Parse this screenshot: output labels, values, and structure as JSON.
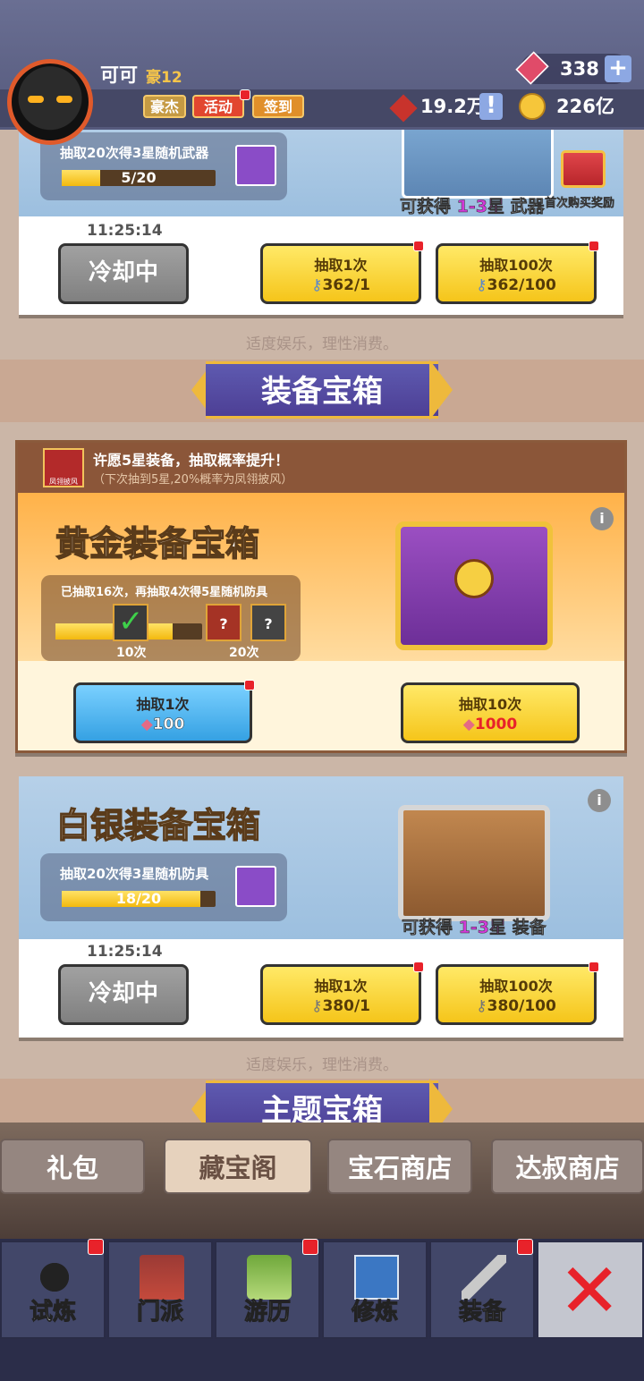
{
  "header": {
    "player_name": "可可",
    "vip_level": "豪12",
    "tag_buttons": [
      "豪杰",
      "活动",
      "签到"
    ],
    "gems": "338",
    "honor": "19.2万",
    "gold": "226亿"
  },
  "weapon_chest": {
    "progress_text": "抽取20次得3星随机武器",
    "progress_value": "5/20",
    "progress_fraction": 0.25,
    "reward_text_prefix": "可获得",
    "reward_stars": "1-3星",
    "reward_type": "武器",
    "first_purchase": "首次购买奖励",
    "timer": "11:25:14",
    "cooldown_label": "冷却中",
    "draw1_label": "抽取1次",
    "draw1_cost": "362/1",
    "draw100_label": "抽取100次",
    "draw100_cost": "362/100",
    "notice": "适度娱乐，理性消费。"
  },
  "equipment_banner": "装备宝箱",
  "wish": {
    "icon_label": "凤翎披风",
    "line1": "许愿5星装备，抽取概率提升！",
    "line2": "（下次抽到5星,20%概率为凤翎披风）"
  },
  "gold_chest": {
    "title": "黄金装备宝箱",
    "progress_text": "已抽取16次，再抽取4次得5星随机防具",
    "progress_fraction": 0.8,
    "mark1": "10次",
    "mark2": "20次",
    "draw1_label": "抽取1次",
    "draw1_cost": "100",
    "draw10_label": "抽取10次",
    "draw10_cost": "1000"
  },
  "silver_chest": {
    "title": "白银装备宝箱",
    "progress_text": "抽取20次得3星随机防具",
    "progress_value": "18/20",
    "progress_fraction": 0.9,
    "reward_text_prefix": "可获得",
    "reward_stars": "1-3星",
    "reward_type": "装备",
    "timer": "11:25:14",
    "cooldown_label": "冷却中",
    "draw1_label": "抽取1次",
    "draw1_cost": "380/1",
    "draw100_label": "抽取100次",
    "draw100_cost": "380/100",
    "notice": "适度娱乐，理性消费。"
  },
  "theme_banner": "主题宝箱",
  "tabs": [
    "礼包",
    "藏宝阁",
    "宝石商店",
    "达叔商店"
  ],
  "active_tab": "藏宝阁",
  "nav": [
    "试炼",
    "门派",
    "游历",
    "修炼",
    "装备"
  ],
  "colors": {
    "accent_yellow": "#f5c51a",
    "accent_blue": "#35a1e3",
    "badge_red": "#e8222a",
    "purple_star": "#d13ad8"
  }
}
